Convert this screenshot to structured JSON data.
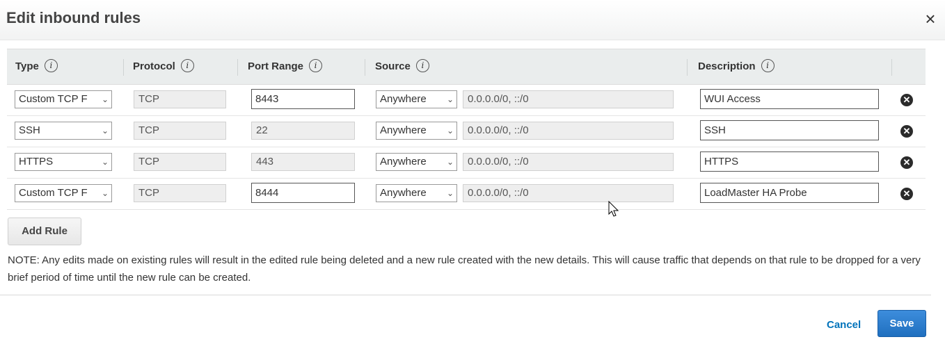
{
  "dialog": {
    "title": "Edit inbound rules",
    "close_glyph": "×"
  },
  "table": {
    "headers": {
      "type": "Type",
      "protocol": "Protocol",
      "port_range": "Port Range",
      "source": "Source",
      "description": "Description"
    },
    "info_glyph": "i",
    "rows": [
      {
        "type": "Custom TCP F",
        "protocol": "TCP",
        "port_range": "8443",
        "source": "Anywhere",
        "cidr": "0.0.0.0/0, ::/0",
        "description": "WUI Access"
      },
      {
        "type": "SSH",
        "protocol": "TCP",
        "port_range": "22",
        "source": "Anywhere",
        "cidr": "0.0.0.0/0, ::/0",
        "description": "SSH"
      },
      {
        "type": "HTTPS",
        "protocol": "TCP",
        "port_range": "443",
        "source": "Anywhere",
        "cidr": "0.0.0.0/0, ::/0",
        "description": "HTTPS"
      },
      {
        "type": "Custom TCP F",
        "protocol": "TCP",
        "port_range": "8444",
        "source": "Anywhere",
        "cidr": "0.0.0.0/0, ::/0",
        "description": "LoadMaster HA Probe"
      }
    ],
    "remove_icon": "remove-circle-icon"
  },
  "actions": {
    "add_rule": "Add Rule",
    "cancel": "Cancel",
    "save": "Save"
  },
  "note": "NOTE: Any edits made on existing rules will result in the edited rule being deleted and a new rule created with the new details. This will cause traffic that depends on that rule to be dropped for a very brief period of time until the new rule can be created.",
  "colors": {
    "primary": "#1f6fbf",
    "link": "#0073bb",
    "header_bg": "#eaeded"
  }
}
